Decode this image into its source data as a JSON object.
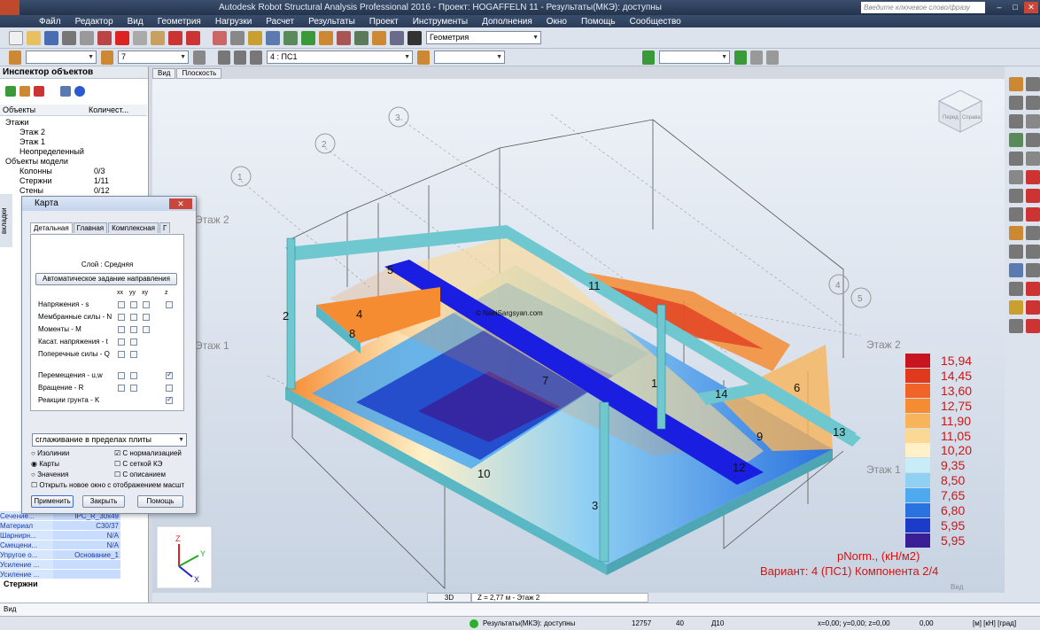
{
  "window": {
    "title": "Autodesk Robot Structural Analysis Professional 2016 - Проект: HOGAFFELN 11 - Результаты(МКЭ): доступны",
    "search_placeholder": "Введите ключевое слово/фразу"
  },
  "menu": [
    "Файл",
    "Редактор",
    "Вид",
    "Геометрия",
    "Нагрузки",
    "Расчет",
    "Результаты",
    "Проект",
    "Инструменты",
    "Дополнения",
    "Окно",
    "Помощь",
    "Сообщество"
  ],
  "toolbar": {
    "layout_combo": "Геометрия",
    "level_combo": "7",
    "case_combo": "4 : ПС1"
  },
  "inspector": {
    "title": "Инспектор объектов",
    "col_objects": "Объекты",
    "col_count": "Количест...",
    "tree": [
      {
        "label": "Этажи",
        "count": "",
        "indent": 0
      },
      {
        "label": "Этаж 2",
        "count": "",
        "indent": 2
      },
      {
        "label": "Этаж 1",
        "count": "",
        "indent": 2
      },
      {
        "label": "Неопределенный",
        "count": "",
        "indent": 2
      },
      {
        "label": "Объекты модели",
        "count": "",
        "indent": 0
      },
      {
        "label": "Колонны",
        "count": "0/3",
        "indent": 2
      },
      {
        "label": "Стержни",
        "count": "1/11",
        "indent": 2
      },
      {
        "label": "Стены",
        "count": "0/12",
        "indent": 2
      }
    ],
    "side_tab": "вкладки",
    "props": [
      {
        "k": "Сечение...",
        "v": "IPC_R_30x49"
      },
      {
        "k": "Материал",
        "v": "C30/37"
      },
      {
        "k": "Шарнирн...",
        "v": "N/A"
      },
      {
        "k": "Смещени...",
        "v": "N/A"
      },
      {
        "k": "Упругое о...",
        "v": "Основание_1"
      },
      {
        "k": "Усиление ...",
        "v": ""
      },
      {
        "k": "Усиление ...",
        "v": ""
      }
    ],
    "bottom_tab": "Стержни"
  },
  "dialog": {
    "title": "Карта",
    "tabs": [
      "Детальная",
      "Главная",
      "Комплексная",
      "Г"
    ],
    "layer": "Слой : Средняя",
    "auto_dir_button": "Автоматическое задание направления",
    "col_headers": [
      "xx",
      "yy",
      "xy",
      "z"
    ],
    "rows": [
      "Напряжения - s",
      "Мембранные силы - N",
      "Моменты - M",
      "Касат. напряжения - t",
      "Поперечные силы - Q",
      "Перемещения - u,w",
      "Вращение - R",
      "Реакции грунта - K"
    ],
    "smoothing": "сглаживание в пределах плиты",
    "radio_isolines": "Изолинии",
    "radio_maps": "Карты",
    "radio_values": "Значения",
    "chk_normalize": "С нормализацией",
    "chk_fe_grid": "С сеткой КЭ",
    "chk_description": "С описанием",
    "chk_new_window": "Открыть новое окно с отображением масшт",
    "btn_apply": "Применить",
    "btn_close": "Закрыть",
    "btn_help": "Помощь"
  },
  "view": {
    "tabs": [
      "Вид",
      "Плоскость"
    ],
    "watermark": "© NairiSargsyan.com",
    "bottom_mode": "3D",
    "bottom_z": "Z = 2,77 м - Этаж 2",
    "corner_label": "Вид",
    "cube_top": "Перед",
    "cube_right": "Справа",
    "storey_labels": [
      "Этаж 2",
      "Этаж 1",
      "Этаж 2",
      "Этаж 1"
    ],
    "member_numbers": [
      "2",
      "3",
      "4",
      "5",
      "6",
      "7",
      "8",
      "9",
      "10",
      "11",
      "12",
      "13",
      "14",
      "1"
    ],
    "grid_bubbles": [
      "1",
      "2",
      "3",
      "4",
      "5"
    ]
  },
  "legend": {
    "values": [
      "15,94",
      "14,45",
      "13,60",
      "12,75",
      "11,90",
      "11,05",
      "10,20",
      "9,35",
      "8,50",
      "7,65",
      "6,80",
      "5,95",
      "5,95"
    ],
    "colors": [
      "#c8141e",
      "#e03a1e",
      "#f0642a",
      "#f58c32",
      "#f7b45a",
      "#fbd893",
      "#fff0c8",
      "#c8ecf8",
      "#8fd0f3",
      "#4ea9ee",
      "#2a72e0",
      "#1a3cc8",
      "#3a1e96"
    ],
    "unit_label": "pNorm., (кН/м2)",
    "case_label": "Вариант: 4 (ПС1) Компонента 2/4"
  },
  "status": {
    "command_line": "Вид",
    "results": "Результаты(МКЭ): доступны",
    "n1": "12757",
    "n2": "40",
    "section": "Д10",
    "coords": "x=0,00; y=0,00; z=0,00",
    "angle": "0,00",
    "units": "[м] [кН] [град]"
  }
}
